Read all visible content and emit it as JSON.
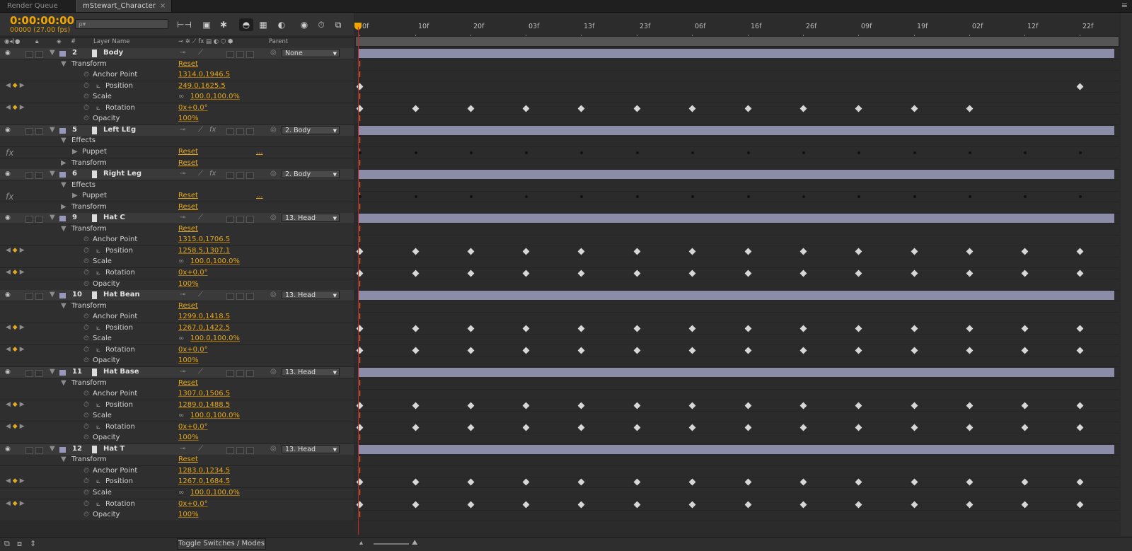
{
  "tabs": [
    {
      "label": "Render Queue",
      "active": false
    },
    {
      "label": "mStewart_Character",
      "active": true,
      "close": "×"
    }
  ],
  "panel_menu_icon": "≡",
  "timecode": "0:00:00:00",
  "frame_info": "00000 (27.00 fps)",
  "search": {
    "placeholder": "ρ▾"
  },
  "toolbar_icons": [
    "composition-mini-flowchart-icon",
    "draft-3d-icon",
    "hide-shy-layers-icon",
    "frame-blending-icon",
    "motion-blur-icon",
    "graph-editor-icon",
    "brainstorm-icon",
    "auto-keyframe-icon"
  ],
  "columns": {
    "num": "#",
    "layer_name": "Layer Name",
    "parent": "Parent"
  },
  "ruler_labels": [
    "0f",
    "10f",
    "20f",
    "03f",
    "13f",
    "23f",
    "06f",
    "16f",
    "26f",
    "09f",
    "19f",
    "02f",
    "12f",
    "22f"
  ],
  "rows": [
    {
      "kind": "layer",
      "num": "2",
      "name": "Body",
      "parent": "None",
      "fx": false
    },
    {
      "kind": "group",
      "name": "Transform",
      "reset": "Reset",
      "indent": 1
    },
    {
      "kind": "prop",
      "name": "Anchor Point",
      "value": "1314.0,1946.5"
    },
    {
      "kind": "prop",
      "name": "Position",
      "value": "249.0,1625.5",
      "keyed": true
    },
    {
      "kind": "prop",
      "name": "Scale",
      "value": "100.0,100.0%",
      "link": true
    },
    {
      "kind": "prop",
      "name": "Rotation",
      "value": "0x+0.0°",
      "keyed": true
    },
    {
      "kind": "prop",
      "name": "Opacity",
      "value": "100%"
    },
    {
      "kind": "layer",
      "num": "5",
      "name": "Left LEg",
      "parent": "2. Body",
      "fx": true
    },
    {
      "kind": "group",
      "name": "Effects",
      "indent": 1
    },
    {
      "kind": "effect",
      "name": "Puppet",
      "reset": "Reset",
      "extra": "...",
      "fxmark": "fx"
    },
    {
      "kind": "group",
      "name": "Transform",
      "reset": "Reset",
      "indent": 1,
      "collapsed": true
    },
    {
      "kind": "layer",
      "num": "6",
      "name": "Right Leg",
      "parent": "2. Body",
      "fx": true
    },
    {
      "kind": "group",
      "name": "Effects",
      "indent": 1
    },
    {
      "kind": "effect",
      "name": "Puppet",
      "reset": "Reset",
      "extra": "...",
      "fxmark": "fx"
    },
    {
      "kind": "group",
      "name": "Transform",
      "reset": "Reset",
      "indent": 1,
      "collapsed": true
    },
    {
      "kind": "layer",
      "num": "9",
      "name": "Hat C",
      "parent": "13. Head",
      "fx": false
    },
    {
      "kind": "group",
      "name": "Transform",
      "reset": "Reset",
      "indent": 1
    },
    {
      "kind": "prop",
      "name": "Anchor Point",
      "value": "1315.0,1706.5"
    },
    {
      "kind": "prop",
      "name": "Position",
      "value": "1258.5,1307.1",
      "keyed": true
    },
    {
      "kind": "prop",
      "name": "Scale",
      "value": "100.0,100.0%",
      "link": true
    },
    {
      "kind": "prop",
      "name": "Rotation",
      "value": "0x+0.0°",
      "keyed": true
    },
    {
      "kind": "prop",
      "name": "Opacity",
      "value": "100%"
    },
    {
      "kind": "layer",
      "num": "10",
      "name": "Hat Bean",
      "parent": "13. Head",
      "fx": false
    },
    {
      "kind": "group",
      "name": "Transform",
      "reset": "Reset",
      "indent": 1
    },
    {
      "kind": "prop",
      "name": "Anchor Point",
      "value": "1299.0,1418.5"
    },
    {
      "kind": "prop",
      "name": "Position",
      "value": "1267.0,1422.5",
      "keyed": true
    },
    {
      "kind": "prop",
      "name": "Scale",
      "value": "100.0,100.0%",
      "link": true
    },
    {
      "kind": "prop",
      "name": "Rotation",
      "value": "0x+0.0°",
      "keyed": true
    },
    {
      "kind": "prop",
      "name": "Opacity",
      "value": "100%"
    },
    {
      "kind": "layer",
      "num": "11",
      "name": "Hat Base",
      "parent": "13. Head",
      "fx": false
    },
    {
      "kind": "group",
      "name": "Transform",
      "reset": "Reset",
      "indent": 1
    },
    {
      "kind": "prop",
      "name": "Anchor Point",
      "value": "1307.0,1506.5"
    },
    {
      "kind": "prop",
      "name": "Position",
      "value": "1289.0,1488.5",
      "keyed": true
    },
    {
      "kind": "prop",
      "name": "Scale",
      "value": "100.0,100.0%",
      "link": true
    },
    {
      "kind": "prop",
      "name": "Rotation",
      "value": "0x+0.0°",
      "keyed": true
    },
    {
      "kind": "prop",
      "name": "Opacity",
      "value": "100%"
    },
    {
      "kind": "layer",
      "num": "12",
      "name": "Hat T",
      "parent": "13. Head",
      "fx": false
    },
    {
      "kind": "group",
      "name": "Transform",
      "reset": "Reset",
      "indent": 1
    },
    {
      "kind": "prop",
      "name": "Anchor Point",
      "value": "1283.0,1234.5"
    },
    {
      "kind": "prop",
      "name": "Position",
      "value": "1267.0,1684.5",
      "keyed": true
    },
    {
      "kind": "prop",
      "name": "Scale",
      "value": "100.0,100.0%",
      "link": true
    },
    {
      "kind": "prop",
      "name": "Rotation",
      "value": "0x+0.0°",
      "keyed": true
    },
    {
      "kind": "prop",
      "name": "Opacity",
      "value": "100%"
    }
  ],
  "keyframes": {
    "body_position": [
      "0f",
      "22f"
    ],
    "body_rotation": [
      "0f",
      "10f",
      "20f",
      "03f",
      "13f",
      "23f",
      "06f",
      "16f",
      "26f",
      "09f",
      "19f",
      "02f"
    ],
    "puppet_left": [
      "0f",
      "10f",
      "20f",
      "03f",
      "13f",
      "23f",
      "06f",
      "16f",
      "26f",
      "09f",
      "19f",
      "02f",
      "12f",
      "22f"
    ],
    "puppet_right": [
      "0f",
      "10f",
      "20f",
      "03f",
      "13f",
      "23f",
      "06f",
      "16f",
      "26f",
      "09f",
      "19f",
      "02f",
      "12f",
      "22f"
    ],
    "full": [
      "0f",
      "10f",
      "20f",
      "03f",
      "13f",
      "23f",
      "06f",
      "16f",
      "26f",
      "09f",
      "19f",
      "02f",
      "12f",
      "22f"
    ]
  },
  "bottom": {
    "toggle_label": "Toggle Switches / Modes"
  },
  "colors": {
    "accent": "#e6a81c",
    "layer_bar": "#8b8ca8",
    "playhead": "#d02020"
  }
}
